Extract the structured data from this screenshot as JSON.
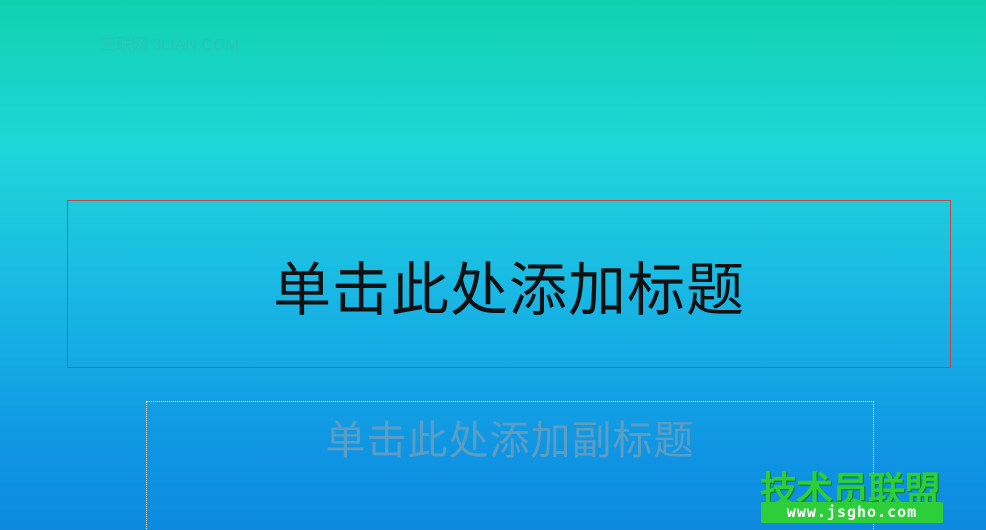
{
  "watermark_top": "三联网 3LIAN.COM",
  "title_placeholder": "单击此处添加标题",
  "subtitle_placeholder": "单击此处添加副标题",
  "watermark_logo": {
    "title": "技术员联盟",
    "url": "www.jsgho.com"
  },
  "colors": {
    "background_top": "#10d2b0",
    "background_bottom": "#0d8ae0",
    "title_border": "#c24848",
    "subtitle_text": "#5d9dc4",
    "logo_green": "#2ccf3a"
  }
}
